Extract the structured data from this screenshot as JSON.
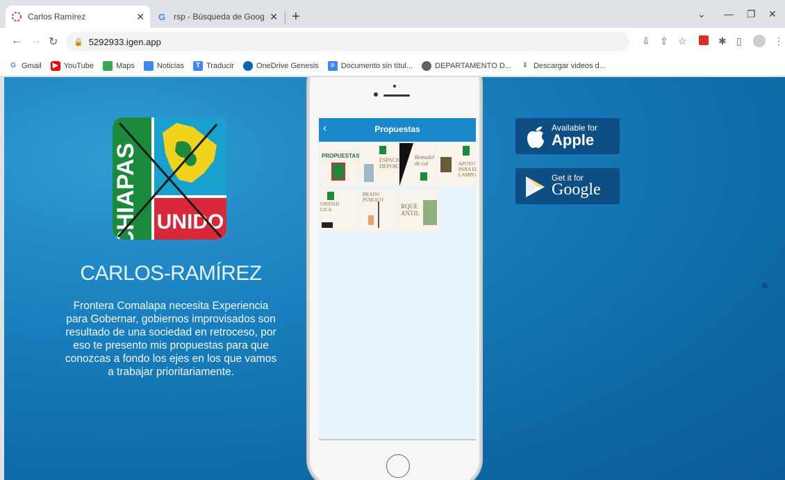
{
  "browser": {
    "tabs": [
      {
        "title": "Carlos Ramírez",
        "active": true
      },
      {
        "title": "rsp - Búsqueda de Google",
        "active": false
      }
    ],
    "url": "5292933.igen.app"
  },
  "bookmarks": [
    {
      "label": "Gmail",
      "icon": "gmail-icon"
    },
    {
      "label": "YouTube",
      "icon": "youtube-icon"
    },
    {
      "label": "Maps",
      "icon": "maps-icon"
    },
    {
      "label": "Noticias",
      "icon": "news-icon"
    },
    {
      "label": "Traducir",
      "icon": "translate-icon"
    },
    {
      "label": "OneDrive Genesis",
      "icon": "onedrive-icon"
    },
    {
      "label": "Documento sin títul...",
      "icon": "docs-icon"
    },
    {
      "label": "DEPARTAMENTO D...",
      "icon": "globe-icon"
    },
    {
      "label": "Descargar videos d...",
      "icon": "download-icon"
    }
  ],
  "page": {
    "logo": {
      "side_text": "CHIAPAS",
      "bottom_text": "UNIDO"
    },
    "title": "CARLOS-RAMÍREZ",
    "description": "Frontera Comalapa necesita Experiencia para Gobernar, gobiernos improvisados son resultado de una sociedad en retroceso, por eso te presento mis propuestas para que conozcas a fondo los ejes en los que vamos a trabajar prioritariamente.",
    "phone": {
      "app_title": "Propuestas",
      "cards": [
        {
          "text": "PROPUESTAS"
        },
        {
          "text": "ESPACIOS DEPORT"
        },
        {
          "text": "Remodel de cal"
        },
        {
          "text": "APOYO PARA EL CAMPO"
        },
        {
          "text": "URIDAD LICA"
        },
        {
          "text": "BRADO PÚBLICO"
        },
        {
          "text": "RQUE ANTIL"
        }
      ]
    },
    "stores": {
      "apple": {
        "line1": "Available for",
        "line2": "Apple"
      },
      "google": {
        "line1": "Get it for",
        "line2": "Google"
      }
    }
  },
  "colors": {
    "background": "#1a80bf",
    "accent": "#0d4f84",
    "logo_green": "#1c8a3c",
    "logo_red": "#d8283a",
    "logo_yellow": "#f1d21c"
  }
}
